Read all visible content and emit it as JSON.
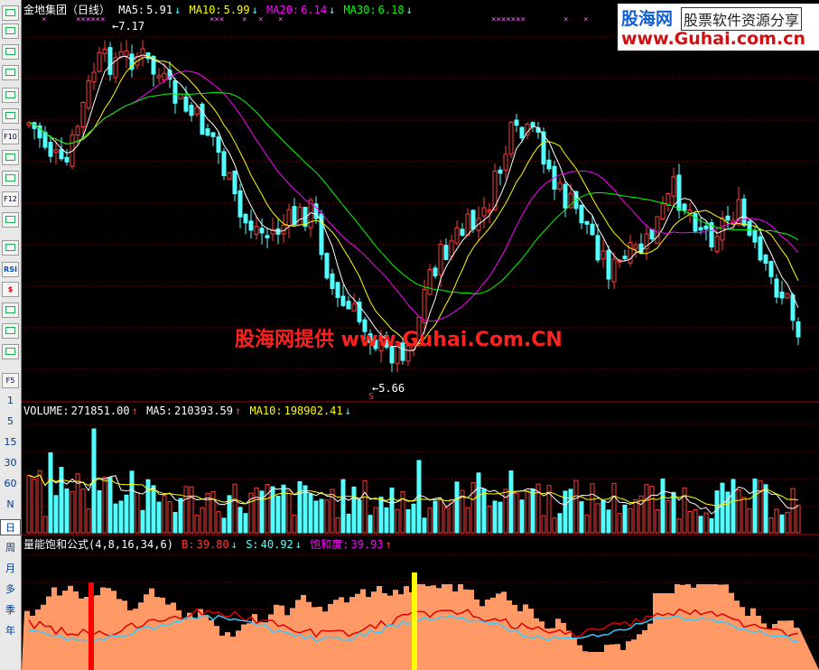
{
  "toolbar": {
    "buttons": [
      "grid",
      "table",
      "line",
      "candle",
      "minute",
      "list",
      "F10",
      "note",
      "memo",
      "F12",
      "search",
      "wave",
      "RSI",
      "dollar",
      "move",
      "exit",
      "pen",
      "F5"
    ],
    "period_numbers": [
      "1",
      "5",
      "15",
      "30",
      "60",
      "N"
    ],
    "periods": [
      "日",
      "周",
      "月",
      "多",
      "季",
      "年"
    ]
  },
  "header_price": {
    "stock": "金地集团（日线）",
    "ma5_label": "MA5:",
    "ma5": "5.91",
    "ma10_label": "MA10:",
    "ma10": "5.99",
    "ma20_label": "MA20:",
    "ma20": "6.14",
    "ma30_label": "MA30:",
    "ma30": "6.18",
    "arrow_down": "↓",
    "arrow_up": "↑"
  },
  "header_volume": {
    "vol_label": "VOLUME:",
    "vol": "271851.00",
    "ma5_label": "MA5:",
    "ma5": "210393.59",
    "ma10_label": "MA10:",
    "ma10": "198902.41"
  },
  "header_indicator": {
    "name": "量能饱和公式(4,8,16,34,6)",
    "b_label": "B:",
    "b": "39.80",
    "s_label": "S:",
    "s": "40.92",
    "sat_label": "饱和度:",
    "sat": "39.93"
  },
  "annotations": {
    "high": "7.17",
    "low": "5.66",
    "low_marker": "S"
  },
  "banner": {
    "logo": "股海网",
    "slogan": "股票软件资源分享",
    "url": "www.Guhai.com.cn"
  },
  "watermark": "股海网提供 www.Guhai.Com.CN",
  "colors": {
    "up": "#ff3b3b",
    "down": "#54ffff",
    "ma5": "#ffffff",
    "ma10": "#ffff00",
    "ma20": "#ff00ff",
    "ma30": "#00ff00",
    "grid": "#8b0000",
    "bars": "#ff9966"
  },
  "chart_data": {
    "type": "candlestick",
    "title": "金地集团（日线）",
    "price_range": [
      5.5,
      7.3
    ],
    "notable": {
      "high": 7.17,
      "low": 5.66
    }
  }
}
